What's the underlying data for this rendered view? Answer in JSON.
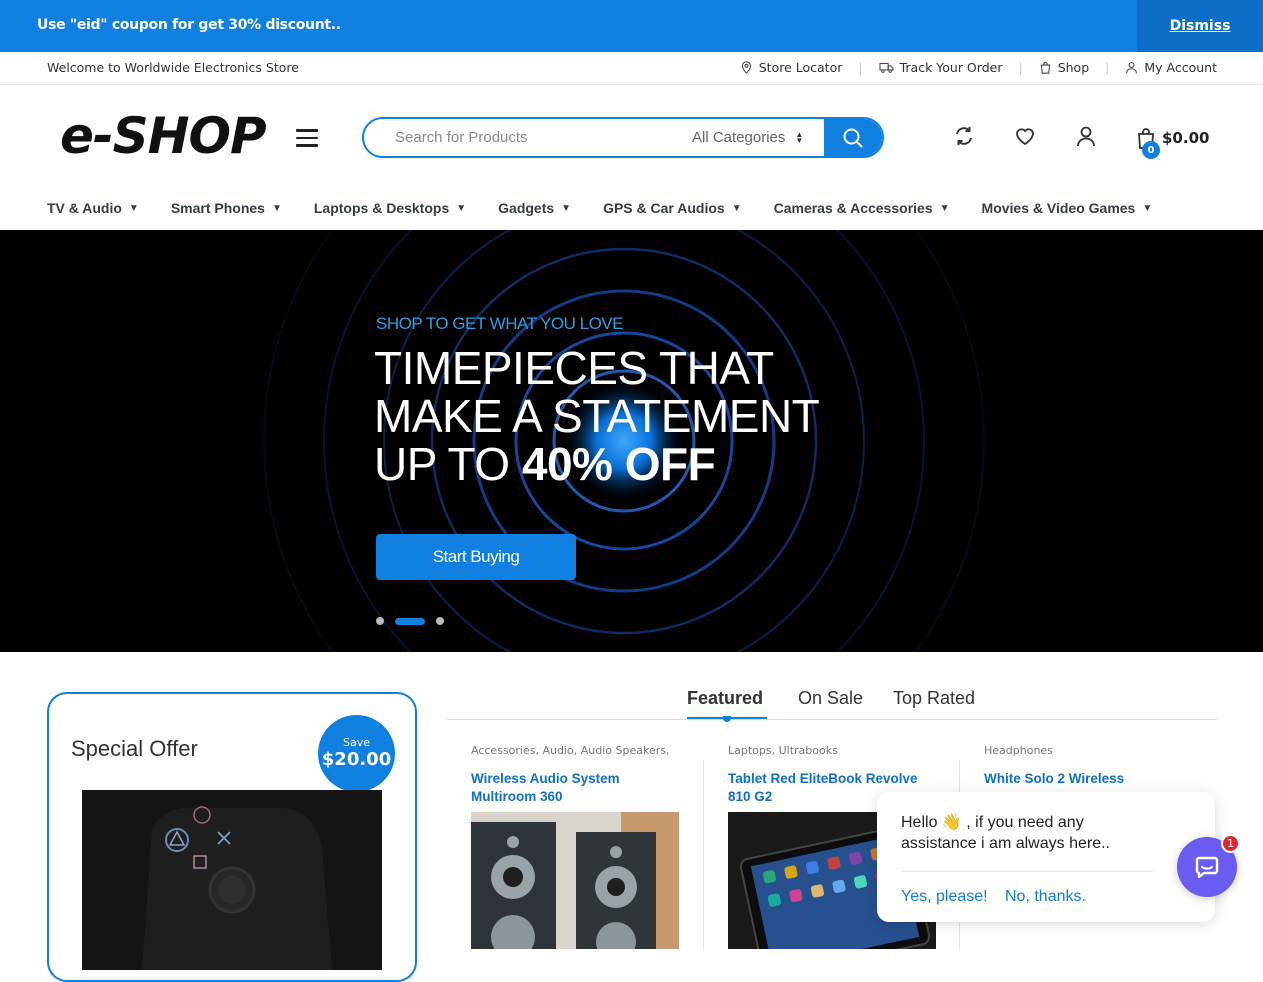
{
  "notice": {
    "text": "Use \"eid\" coupon for get 30% discount..",
    "dismiss": "Dismiss"
  },
  "topbar": {
    "welcome": "Welcome to Worldwide Electronics Store",
    "links": [
      "Store Locator",
      "Track Your Order",
      "Shop",
      "My Account"
    ]
  },
  "header": {
    "logo": "e-SHOP",
    "search_placeholder": "Search for Products",
    "category": "All Categories",
    "cart_count": "0",
    "cart_total": "$0.00"
  },
  "nav": [
    "TV & Audio",
    "Smart Phones",
    "Laptops & Desktops",
    "Gadgets",
    "GPS & Car Audios",
    "Cameras & Accessories",
    "Movies & Video Games"
  ],
  "hero": {
    "subtitle": "SHOP TO GET WHAT YOU LOVE",
    "title_line1": "TIMEPIECES THAT",
    "title_line2": "MAKE A STATEMENT",
    "title_line3_pre": "UP TO ",
    "title_line3_bold": "40% OFF",
    "cta": "Start Buying",
    "slides": 3,
    "active_slide": 2
  },
  "special_offer": {
    "title": "Special Offer",
    "save_label": "Save",
    "save_amount": "$20.00"
  },
  "tabs": [
    "Featured",
    "On Sale",
    "Top Rated"
  ],
  "products": [
    {
      "category": "Accessories, Audio, Audio Speakers,",
      "name": "Wireless Audio System Multiroom 360"
    },
    {
      "category": "Laptops, Ultrabooks",
      "name": "Tablet Red EliteBook Revolve 810 G2"
    },
    {
      "category": "Headphones",
      "name": "White Solo 2 Wireless"
    }
  ],
  "chat": {
    "message": "Hello 👋 , if you need any assistance i am always here..",
    "yes": "Yes, please!",
    "no": "No, thanks.",
    "badge": "1"
  },
  "colors": {
    "accent": "#0f7fe0",
    "chat": "#6a5bf2"
  }
}
